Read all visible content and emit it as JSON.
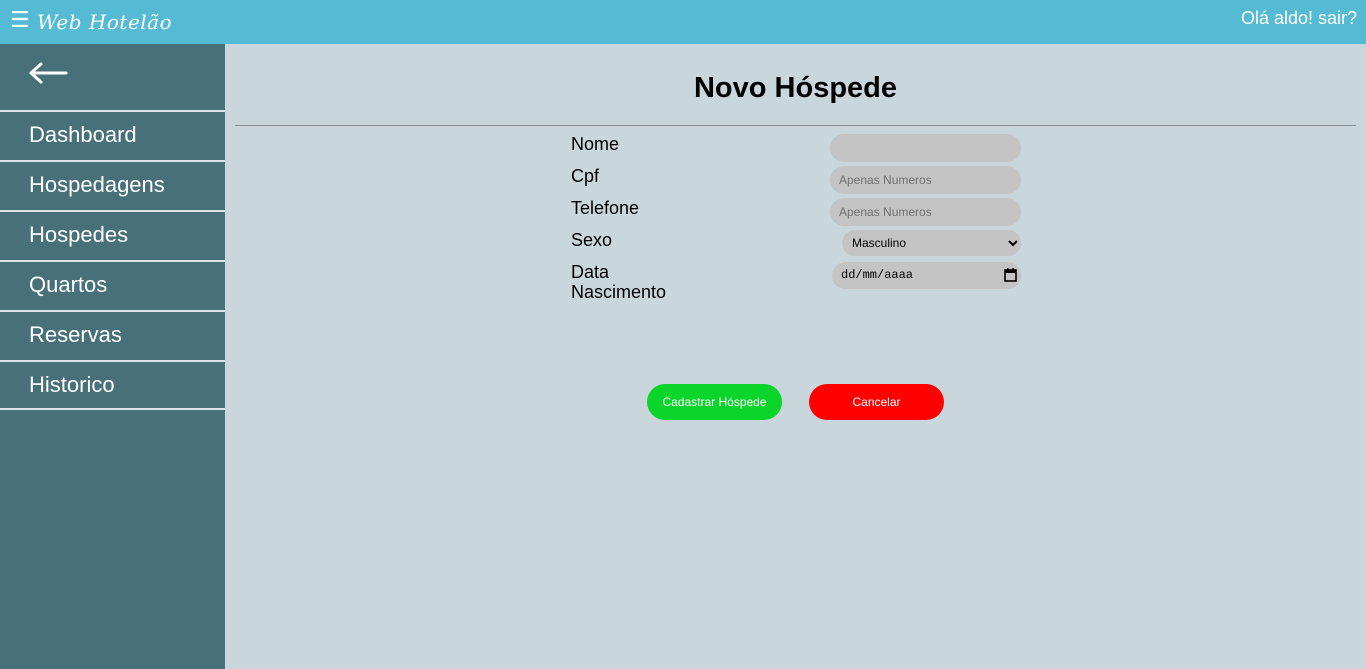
{
  "header": {
    "menu_glyph": "☰",
    "brand": "Web Hotelão",
    "greeting": "Olá aldo! sair?"
  },
  "sidebar": {
    "items": [
      {
        "label": "Dashboard"
      },
      {
        "label": "Hospedagens"
      },
      {
        "label": "Hospedes"
      },
      {
        "label": "Quartos"
      },
      {
        "label": "Reservas"
      },
      {
        "label": "Historico"
      }
    ]
  },
  "main": {
    "title": "Novo Hóspede",
    "form": {
      "nome": {
        "label": "Nome",
        "value": "",
        "placeholder": ""
      },
      "cpf": {
        "label": "Cpf",
        "value": "",
        "placeholder": "Apenas Numeros"
      },
      "telefone": {
        "label": "Telefone",
        "value": "",
        "placeholder": "Apenas Numeros"
      },
      "sexo": {
        "label": "Sexo",
        "selected": "Masculino"
      },
      "nascimento": {
        "label": "Data Nascimento",
        "value": "dd/mm/aaaa"
      }
    },
    "buttons": {
      "submit": "Cadastrar Hóspede",
      "cancel": "Cancelar"
    }
  },
  "colors": {
    "topbar": "#55bad3",
    "sidebar": "#477079",
    "content_bg": "#c9d6dc",
    "submit": "#0bd42b",
    "cancel": "#ff0000"
  }
}
